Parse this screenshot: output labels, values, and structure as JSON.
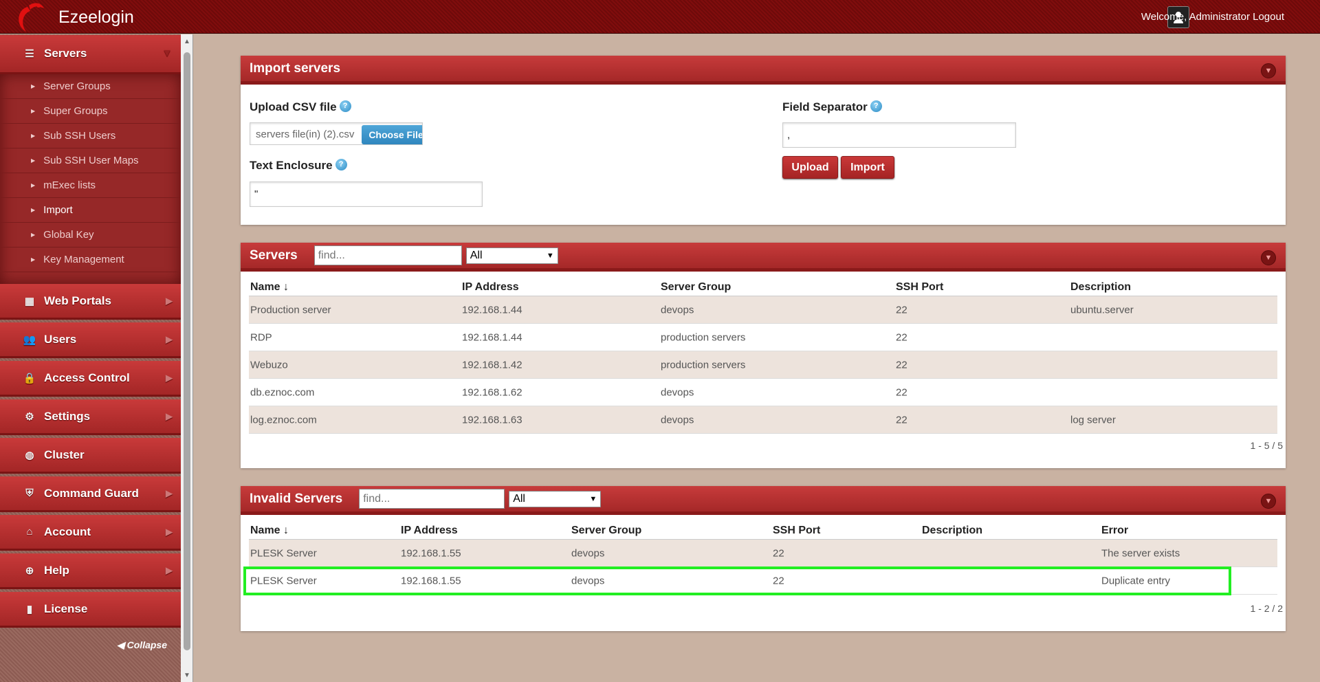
{
  "header": {
    "brand": "Ezeelogin",
    "welcome": "Welcome, Administrator",
    "logout": "Logout"
  },
  "sidebar": {
    "servers_label": "Servers",
    "subitems": [
      "Server Groups",
      "Super Groups",
      "Sub SSH Users",
      "Sub SSH User Maps",
      "mExec lists",
      "Import",
      "Global Key",
      "Key Management"
    ],
    "items": [
      "Web Portals",
      "Users",
      "Access Control",
      "Settings",
      "Cluster",
      "Command Guard",
      "Account",
      "Help",
      "License"
    ],
    "collapse": "Collapse"
  },
  "import": {
    "title": "Import servers",
    "upload_label": "Upload CSV file",
    "file_name": "servers file(in) (2).csv",
    "choose": "Choose File",
    "enclosure_label": "Text Enclosure",
    "enclosure_value": "\"",
    "separator_label": "Field Separator",
    "separator_value": ",",
    "upload_btn": "Upload",
    "import_btn": "Import",
    "help": "?"
  },
  "servers": {
    "title": "Servers",
    "find_placeholder": "find...",
    "filter": "All",
    "columns": [
      "Name",
      "IP Address",
      "Server Group",
      "SSH Port",
      "Description"
    ],
    "sort_icon": "↓",
    "rows": [
      [
        "Production server",
        "192.168.1.44",
        "devops",
        "22",
        "ubuntu.server"
      ],
      [
        "RDP",
        "192.168.1.44",
        "production servers",
        "22",
        ""
      ],
      [
        "Webuzo",
        "192.168.1.42",
        "production servers",
        "22",
        ""
      ],
      [
        "db.eznoc.com",
        "192.168.1.62",
        "devops",
        "22",
        ""
      ],
      [
        "log.eznoc.com",
        "192.168.1.63",
        "devops",
        "22",
        "log server"
      ]
    ],
    "pager": "1 - 5 / 5"
  },
  "invalid": {
    "title": "Invalid Servers",
    "find_placeholder": "find...",
    "filter": "All",
    "columns": [
      "Name",
      "IP Address",
      "Server Group",
      "SSH Port",
      "Description",
      "Error"
    ],
    "rows": [
      [
        "PLESK Server",
        "192.168.1.55",
        "devops",
        "22",
        "",
        "The server exists"
      ],
      [
        "PLESK Server",
        "192.168.1.55",
        "devops",
        "22",
        "",
        "Duplicate entry"
      ]
    ],
    "pager": "1 - 2 / 2"
  }
}
